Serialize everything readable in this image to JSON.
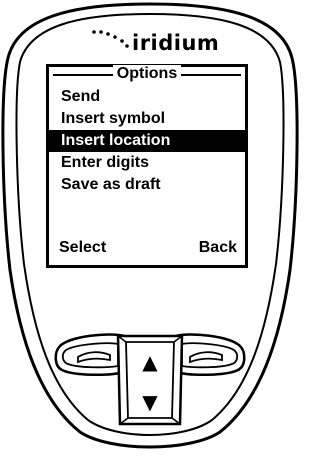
{
  "brand": {
    "name": "iridium"
  },
  "screen": {
    "title": "Options",
    "menu_items": [
      {
        "label": "Send",
        "selected": false
      },
      {
        "label": "Insert symbol",
        "selected": false
      },
      {
        "label": "Insert location",
        "selected": true
      },
      {
        "label": "Enter digits",
        "selected": false
      },
      {
        "label": "Save as draft",
        "selected": false
      }
    ],
    "softkeys": {
      "left": "Select",
      "right": "Back"
    }
  },
  "keys": {
    "up_arrow": "▲",
    "down_arrow": "▼",
    "icons": [
      "send-key-icon",
      "end-key-icon",
      "up-arrow-icon",
      "down-arrow-icon"
    ]
  }
}
